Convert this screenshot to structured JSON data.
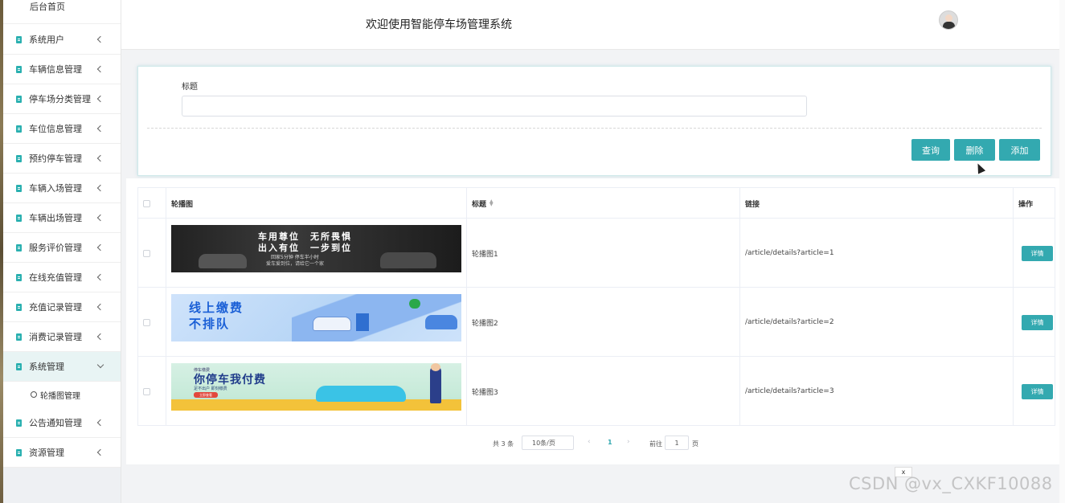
{
  "header": {
    "title": "欢迎使用智能停车场管理系统"
  },
  "sidebar": {
    "home": "后台首页",
    "items": [
      {
        "label": "系统用户"
      },
      {
        "label": "车辆信息管理"
      },
      {
        "label": "停车场分类管理"
      },
      {
        "label": "车位信息管理"
      },
      {
        "label": "预约停车管理"
      },
      {
        "label": "车辆入场管理"
      },
      {
        "label": "车辆出场管理"
      },
      {
        "label": "服务评价管理"
      },
      {
        "label": "在线充值管理"
      },
      {
        "label": "充值记录管理"
      },
      {
        "label": "消费记录管理"
      },
      {
        "label": "系统管理"
      },
      {
        "label": "公告通知管理"
      },
      {
        "label": "资源管理"
      }
    ],
    "active_item": "系统管理",
    "sub_item": "轮播图管理"
  },
  "search": {
    "label": "标题",
    "value": ""
  },
  "buttons": {
    "query": "查询",
    "delete": "删除",
    "add": "添加"
  },
  "table": {
    "columns": [
      "轮播图",
      "标题",
      "链接",
      "操作"
    ],
    "rows": [
      {
        "title": "轮播图1",
        "link": "/article/details?article=1",
        "action": "详情",
        "banner_text": [
          "车用尊位　无所畏惧",
          "出入有位　一步到位",
          "回家5分钟 停车半小时",
          "爱车爱到位，请给它一个家"
        ]
      },
      {
        "title": "轮播图2",
        "link": "/article/details?article=2",
        "action": "详情",
        "banner_text": [
          "线上缴费",
          "不排队"
        ]
      },
      {
        "title": "轮播图3",
        "link": "/article/details?article=3",
        "action": "详情",
        "banner_text": [
          "停车缴费",
          "你停车我付费",
          "足不出户 即刻缴费",
          "立即查看"
        ]
      }
    ]
  },
  "pagination": {
    "total": "共 3 条",
    "page_size": "10条/页",
    "current_page": "1",
    "goto_label": "前往",
    "goto_value": "1",
    "page_suffix": "页"
  },
  "overlay": {
    "close": "x",
    "watermark": "CSDN @vx_CXKF10088"
  },
  "colors": {
    "accent": "#33a9b0",
    "menu_icon": "#2ab0b0"
  }
}
